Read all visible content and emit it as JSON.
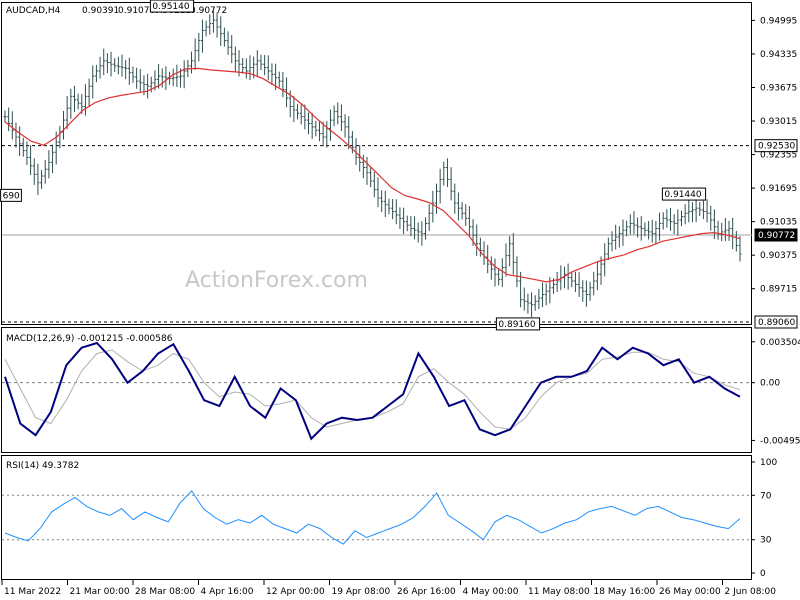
{
  "chart_data": [
    {
      "type": "ohlc",
      "title": "AUDCAD,H4",
      "ohlc_readout": [
        "0.90391",
        "0.91070",
        "0.90211",
        "0.90772"
      ],
      "watermark": "ActionForex.com",
      "ylim": [
        0.8906,
        0.952
      ],
      "y_ticks": [
        "0.94995",
        "0.94335",
        "0.93675",
        "0.93015",
        "0.92355",
        "0.91695",
        "0.91035",
        "0.90375",
        "0.89715"
      ],
      "levels": [
        {
          "value": 0.9253,
          "label": "0.92530",
          "style": "dashed"
        },
        {
          "value": 0.8906,
          "label": "0.89060",
          "style": "dashed"
        },
        {
          "value": 0.90772,
          "label": "0.90772",
          "style": "solid"
        }
      ],
      "annotations": [
        {
          "label": "0.95140",
          "value": 0.9514
        },
        {
          "label": "0.91440",
          "value": 0.9144
        },
        {
          "label": "0.89160",
          "value": 0.8916
        },
        {
          "label": "690",
          "value": 0.9169
        }
      ],
      "series": [
        {
          "kind": "price",
          "color": "#2f4f4f",
          "values": [
            0.931,
            0.927,
            0.923,
            0.918,
            0.922,
            0.928,
            0.935,
            0.933,
            0.939,
            0.942,
            0.941,
            0.9405,
            0.938,
            0.937,
            0.939,
            0.9385,
            0.939,
            0.942,
            0.948,
            0.95,
            0.946,
            0.942,
            0.94,
            0.942,
            0.94,
            0.938,
            0.933,
            0.931,
            0.929,
            0.927,
            0.932,
            0.929,
            0.923,
            0.92,
            0.915,
            0.913,
            0.911,
            0.909,
            0.908,
            0.914,
            0.921,
            0.914,
            0.911,
            0.906,
            0.902,
            0.899,
            0.906,
            0.895,
            0.894,
            0.896,
            0.898,
            0.9,
            0.898,
            0.896,
            0.9,
            0.906,
            0.908,
            0.91,
            0.909,
            0.908,
            0.911,
            0.91,
            0.912,
            0.913,
            0.912,
            0.908,
            0.909,
            0.904
          ]
        },
        {
          "kind": "moving_average",
          "color": "#e03030",
          "values": [
            0.93,
            0.928,
            0.9262,
            0.9254,
            0.927,
            0.9296,
            0.9322,
            0.9338,
            0.9347,
            0.9352,
            0.9356,
            0.936,
            0.9372,
            0.9392,
            0.9404,
            0.9405,
            0.9402,
            0.94,
            0.9398,
            0.9395,
            0.9385,
            0.937,
            0.9355,
            0.9335,
            0.931,
            0.9288,
            0.9268,
            0.9245,
            0.922,
            0.9195,
            0.917,
            0.9155,
            0.9148,
            0.914,
            0.9125,
            0.91,
            0.9075,
            0.904,
            0.9015,
            0.8999,
            0.8995,
            0.899,
            0.8985,
            0.899,
            0.9005,
            0.9015,
            0.9025,
            0.9032,
            0.9038,
            0.9048,
            0.9055,
            0.9065,
            0.907,
            0.9075,
            0.908,
            0.9082,
            0.9077,
            0.907
          ]
        }
      ]
    },
    {
      "type": "line",
      "title": "MACD(12,26,9) -0.001215 -0.000586",
      "ylim": [
        -0.0056,
        0.004
      ],
      "y_ticks": [
        "0.003504",
        "0.00",
        "-0.004953"
      ],
      "series": [
        {
          "kind": "macd",
          "color": "#000080",
          "values": [
            0.0005,
            -0.0035,
            -0.0045,
            -0.0025,
            0.0015,
            0.003,
            0.0034,
            0.002,
            0.0,
            0.001,
            0.0025,
            0.0033,
            0.001,
            -0.0015,
            -0.002,
            0.0005,
            -0.002,
            -0.003,
            -0.0005,
            -0.0015,
            -0.0048,
            -0.0035,
            -0.003,
            -0.0032,
            -0.003,
            -0.002,
            -0.001,
            0.0025,
            0.0005,
            -0.002,
            -0.0015,
            -0.004,
            -0.0045,
            -0.004,
            -0.002,
            0.0,
            0.0005,
            0.0005,
            0.001,
            0.003,
            0.002,
            0.003,
            0.0025,
            0.0015,
            0.002,
            0.0,
            0.0005,
            -0.0005,
            -0.0012
          ]
        },
        {
          "kind": "signal",
          "color": "#b0b0b0",
          "values": [
            0.002,
            -0.0005,
            -0.003,
            -0.0035,
            -0.0015,
            0.001,
            0.0025,
            0.0028,
            0.0018,
            0.001,
            0.0015,
            0.0025,
            0.002,
            0.0,
            -0.0012,
            -0.0008,
            -0.001,
            -0.002,
            -0.0018,
            -0.0015,
            -0.003,
            -0.0038,
            -0.0035,
            -0.0032,
            -0.003,
            -0.0025,
            -0.0018,
            0.0005,
            0.0012,
            0.0,
            -0.001,
            -0.0025,
            -0.0038,
            -0.004,
            -0.003,
            -0.0012,
            0.0,
            0.0005,
            0.0008,
            0.002,
            0.0022,
            0.0026,
            0.0026,
            0.002,
            0.0018,
            0.0008,
            0.0005,
            -0.0002,
            -0.0006
          ]
        }
      ]
    },
    {
      "type": "line",
      "title": "RSI(14) 49.3782",
      "ylim": [
        0,
        100
      ],
      "y_ticks": [
        "100",
        "70",
        "30",
        "0"
      ],
      "levels": [
        {
          "value": 70,
          "style": "dotted"
        },
        {
          "value": 30,
          "style": "dotted"
        }
      ],
      "x_tick_labels": [
        "11 Mar 2022",
        "21 Mar 00:00",
        "28 Mar 08:00",
        "4 Apr 16:00",
        "12 Apr 00:00",
        "19 Apr 08:00",
        "26 Apr 16:00",
        "4 May 00:00",
        "11 May 08:00",
        "18 May 16:00",
        "26 May 00:00",
        "2 Jun 08:00"
      ],
      "series": [
        {
          "kind": "rsi",
          "color": "#1e90ff",
          "values": [
            36,
            32,
            29,
            40,
            55,
            62,
            68,
            60,
            55,
            52,
            58,
            48,
            55,
            50,
            46,
            63,
            74,
            58,
            50,
            44,
            48,
            45,
            52,
            44,
            40,
            36,
            44,
            40,
            32,
            26,
            38,
            32,
            36,
            40,
            44,
            50,
            60,
            72,
            52,
            45,
            38,
            30,
            46,
            52,
            48,
            42,
            36,
            40,
            45,
            48,
            55,
            58,
            60,
            56,
            52,
            58,
            60,
            55,
            50,
            48,
            45,
            42,
            40,
            49
          ]
        }
      ]
    }
  ]
}
